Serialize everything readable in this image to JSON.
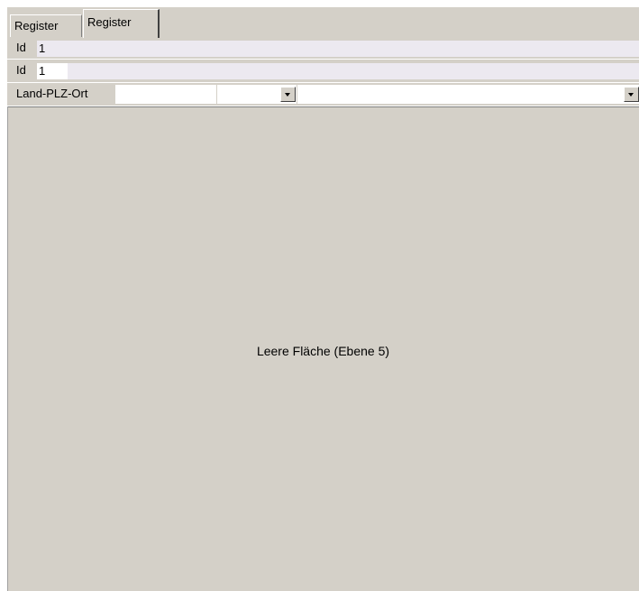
{
  "tabs": [
    {
      "label": "Register",
      "active": false
    },
    {
      "label": "Register",
      "active": true
    }
  ],
  "fields": {
    "id_label_1": "Id",
    "id_value_1": "1",
    "id_label_2": "Id",
    "id_value_2": "1",
    "land_plz_ort_label": "Land-PLZ-Ort",
    "land_value": "",
    "plz_value": "",
    "ort_value": ""
  },
  "empty_area": {
    "text": "Leere Fläche (Ebene 5)"
  },
  "icons": {
    "dropdown": "chevron-down-icon"
  },
  "colors": {
    "panel": "#d4d0c8",
    "field_readonly": "#ece9f0",
    "field_edit": "#ffffff"
  }
}
